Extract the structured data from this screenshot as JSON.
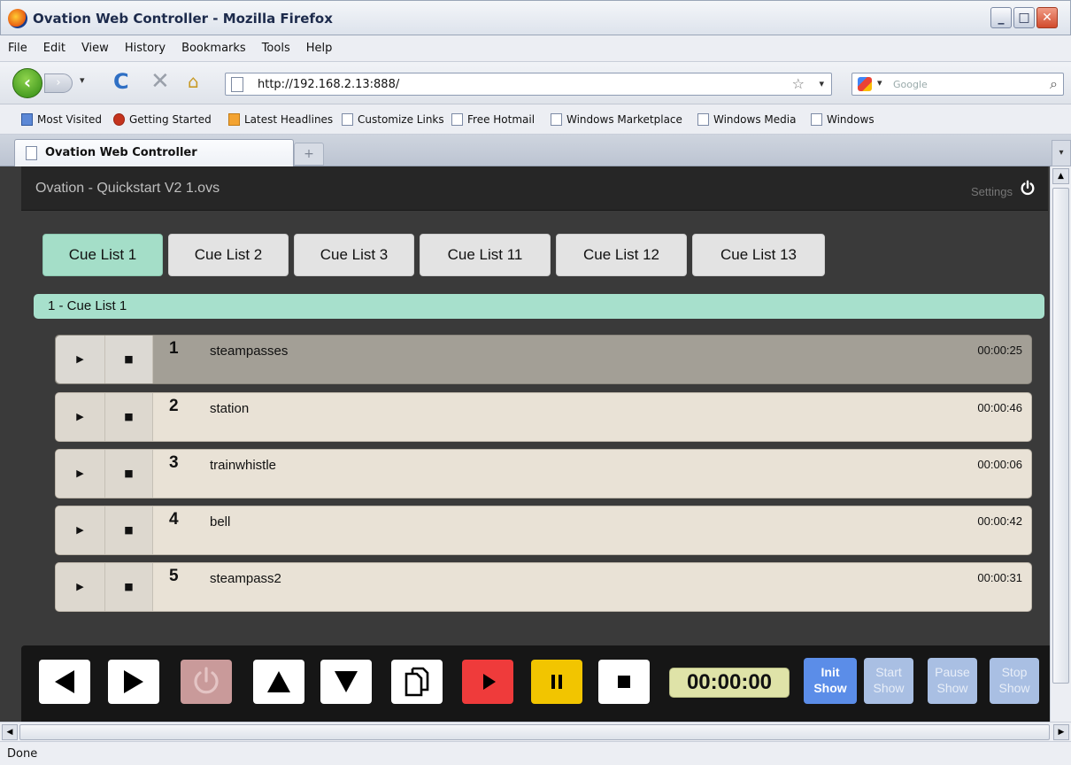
{
  "window": {
    "title": "Ovation Web Controller - Mozilla Firefox",
    "controls": [
      "minimize",
      "maximize",
      "close"
    ]
  },
  "menu": [
    "File",
    "Edit",
    "View",
    "History",
    "Bookmarks",
    "Tools",
    "Help"
  ],
  "nav": {
    "url": "http://192.168.2.13:888/",
    "search_placeholder": "Google"
  },
  "bookmarks": [
    "Most Visited",
    "Getting Started",
    "Latest Headlines",
    "Customize Links",
    "Free Hotmail",
    "Windows Marketplace",
    "Windows Media",
    "Windows"
  ],
  "tab": {
    "title": "Ovation Web Controller",
    "new_tab": "+"
  },
  "app": {
    "title": "Ovation - Quickstart V2 1.ovs",
    "settings_label": "Settings",
    "cue_tabs": [
      "Cue List 1",
      "Cue List 2",
      "Cue List 3",
      "Cue List 11",
      "Cue List 12",
      "Cue List 13"
    ],
    "active_tab": "Cue List 1",
    "list_title": "1 - Cue List 1",
    "cues": [
      {
        "number": "1",
        "name": "steampasses",
        "duration": "00:00:25",
        "selected": true
      },
      {
        "number": "2",
        "name": "station",
        "duration": "00:00:46",
        "selected": false
      },
      {
        "number": "3",
        "name": "trainwhistle",
        "duration": "00:00:06",
        "selected": false
      },
      {
        "number": "4",
        "name": "bell",
        "duration": "00:00:42",
        "selected": false
      },
      {
        "number": "5",
        "name": "steampass2",
        "duration": "00:00:31",
        "selected": false
      }
    ],
    "cue_play_glyph": "▶",
    "cue_stop_glyph": "■",
    "timer": "00:00:00",
    "show_buttons": {
      "init": [
        "Init",
        "Show"
      ],
      "start": [
        "Start",
        "Show"
      ],
      "pause": [
        "Pause",
        "Show"
      ],
      "stop": [
        "Stop",
        "Show"
      ]
    }
  },
  "status": "Done",
  "colors": {
    "active_tab": "#a4dec8",
    "list_bar": "#a7e0cc",
    "selected_cue": "#a39f96",
    "cue_row": "#e9e2d6",
    "play_button": "#ef3b3b",
    "pause_button": "#f2c500",
    "init_show": "#5b8de8",
    "timer_bg": "#dfe3a8"
  }
}
